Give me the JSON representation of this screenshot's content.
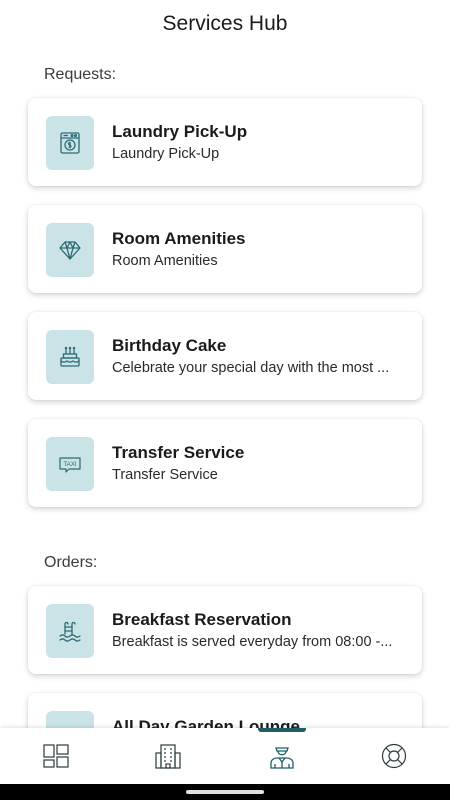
{
  "header": {
    "title": "Services Hub"
  },
  "sections": {
    "requests_label": "Requests:",
    "orders_label": "Orders:"
  },
  "requests": [
    {
      "title": "Laundry Pick-Up",
      "subtitle": "Laundry Pick-Up",
      "icon": "washing-machine-icon"
    },
    {
      "title": "Room Amenities",
      "subtitle": "Room Amenities",
      "icon": "diamond-icon"
    },
    {
      "title": "Birthday Cake",
      "subtitle": "Celebrate your special day with the most ...",
      "icon": "cake-icon"
    },
    {
      "title": "Transfer Service",
      "subtitle": "Transfer Service",
      "icon": "taxi-icon"
    }
  ],
  "orders": [
    {
      "title": "Breakfast Reservation",
      "subtitle": "Breakfast is served everyday from 08:00 -...",
      "icon": "pool-icon"
    },
    {
      "title": "All Day Garden Lounge",
      "subtitle": "",
      "icon": "lounge-icon"
    }
  ],
  "taxi_icon_text": "TAXI",
  "bottom_nav": [
    {
      "icon": "dashboard-icon",
      "active": false
    },
    {
      "icon": "hotel-building-icon",
      "active": false
    },
    {
      "icon": "concierge-icon",
      "active": true
    },
    {
      "icon": "lifebuoy-icon",
      "active": false
    }
  ],
  "colors": {
    "accent": "#1f5f68",
    "icon_bg": "#c9e3e6",
    "icon_stroke": "#2d6b73"
  }
}
